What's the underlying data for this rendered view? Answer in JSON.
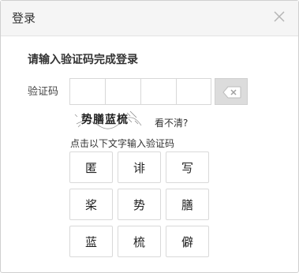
{
  "dialog": {
    "title": "登录",
    "subtitle": "请输入验证码完成登录",
    "code_label": "验证码",
    "captcha_text": "势膳蓝梳",
    "refresh_label": "看不清?",
    "instruction": "点击以下文字输入验证码",
    "characters": [
      "匿",
      "诽",
      "写",
      "桨",
      "势",
      "膳",
      "蓝",
      "梳",
      "僻"
    ]
  }
}
